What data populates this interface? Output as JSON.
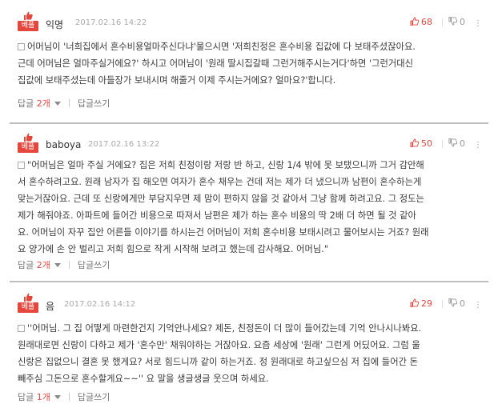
{
  "comments": [
    {
      "badge": "베플",
      "user": "익명",
      "date": "2017.02.16 14:22",
      "likes": "68",
      "dislikes": "0",
      "text": "어머님이 '너희집에서 혼수비용얼마주신다냐'물으시면 '저희친정은 혼수비용 집값에 다 보태주셨잖아요.\n근데 어머님은 얼마주실거에요?' 하시고 어머님이 '원래 딸시집갈때 그런거해주시는거다'하면 '그런거대신\n집값에 보태주셨는데 아들장가 보내시며 해줄거 이제 주시는거에요? 얼마요?'합니다.",
      "reply_label": "답글",
      "reply_count": "2개",
      "write_label": "답글쓰기"
    },
    {
      "badge": "베플",
      "user": "baboya",
      "date": "2017.02.16 13:22",
      "likes": "50",
      "dislikes": "0",
      "text": "\"어머님은 얼마 주실 거에요? 집은 저희 친정이랑 저랑 반 하고, 신랑 1/4 밖에 못 보탰으니까 그거 감안해\n서 혼수하려고요. 원래 남자가 집 해오면 여자가 혼수 채우는 건데 저는 제가 더 냈으니까 남편이 혼수하는게\n맞는거잖아요. 근데 또 신랑에게만 부담지우면 제 맘이 편하지 않을 것 같아서 그냥 함께 하려고요. 그 정도는\n제가 해줘야죠. 아파트에 들어간 비용으로 따져서 남편은 제가 하는 혼수 비용의 딱 2배 더 하면 될 것 같아\n요. 어머님이 자꾸 집안 어른들 이야기를 하시는건 어머님이 저희 혼수비용 보태시려고 물어보시는 거죠? 원래\n요 양가에 손 안 벌리고 저희 힘으로 작게 시작해 보려고 했는데 감사해요. 어머님.\"",
      "reply_label": "답글",
      "reply_count": "2개",
      "write_label": "답글쓰기"
    },
    {
      "badge": "베플",
      "user": "음",
      "date": "2017.02.16 14:12",
      "likes": "29",
      "dislikes": "0",
      "text": "''어머님. 그 집 어떻게 마련한건지 기억안나세요? 제돈, 친정돈이 더 많이 들어갔는데 기억 안나시나봐요.\n원래대로면 신랑이 다하고 제가 '혼수만' 채워야하는 거잖아요. 요즘 세상에 '원래' 그런게 어딨어요. 그럼 울\n신랑은 집없으니 결혼 못 했게요? 서로 힘드니까 같이 하는거죠. 정 원래대로 하고싶으심 저 집에 들어간 돈\n빼주심 그돈으로 혼수할게요~~'' 요 말을 생글생글 웃으며 하세요.",
      "reply_label": "답글",
      "reply_count": "1개",
      "write_label": "답글쓰기"
    }
  ],
  "colors": {
    "accent": "#e5473d",
    "muted": "#999999",
    "divider": "#bdbdbd"
  },
  "icons": {
    "badge": "thumbs-up-icon",
    "like": "thumbs-up-icon",
    "dislike": "thumbs-down-icon",
    "more": "more-options-icon"
  }
}
